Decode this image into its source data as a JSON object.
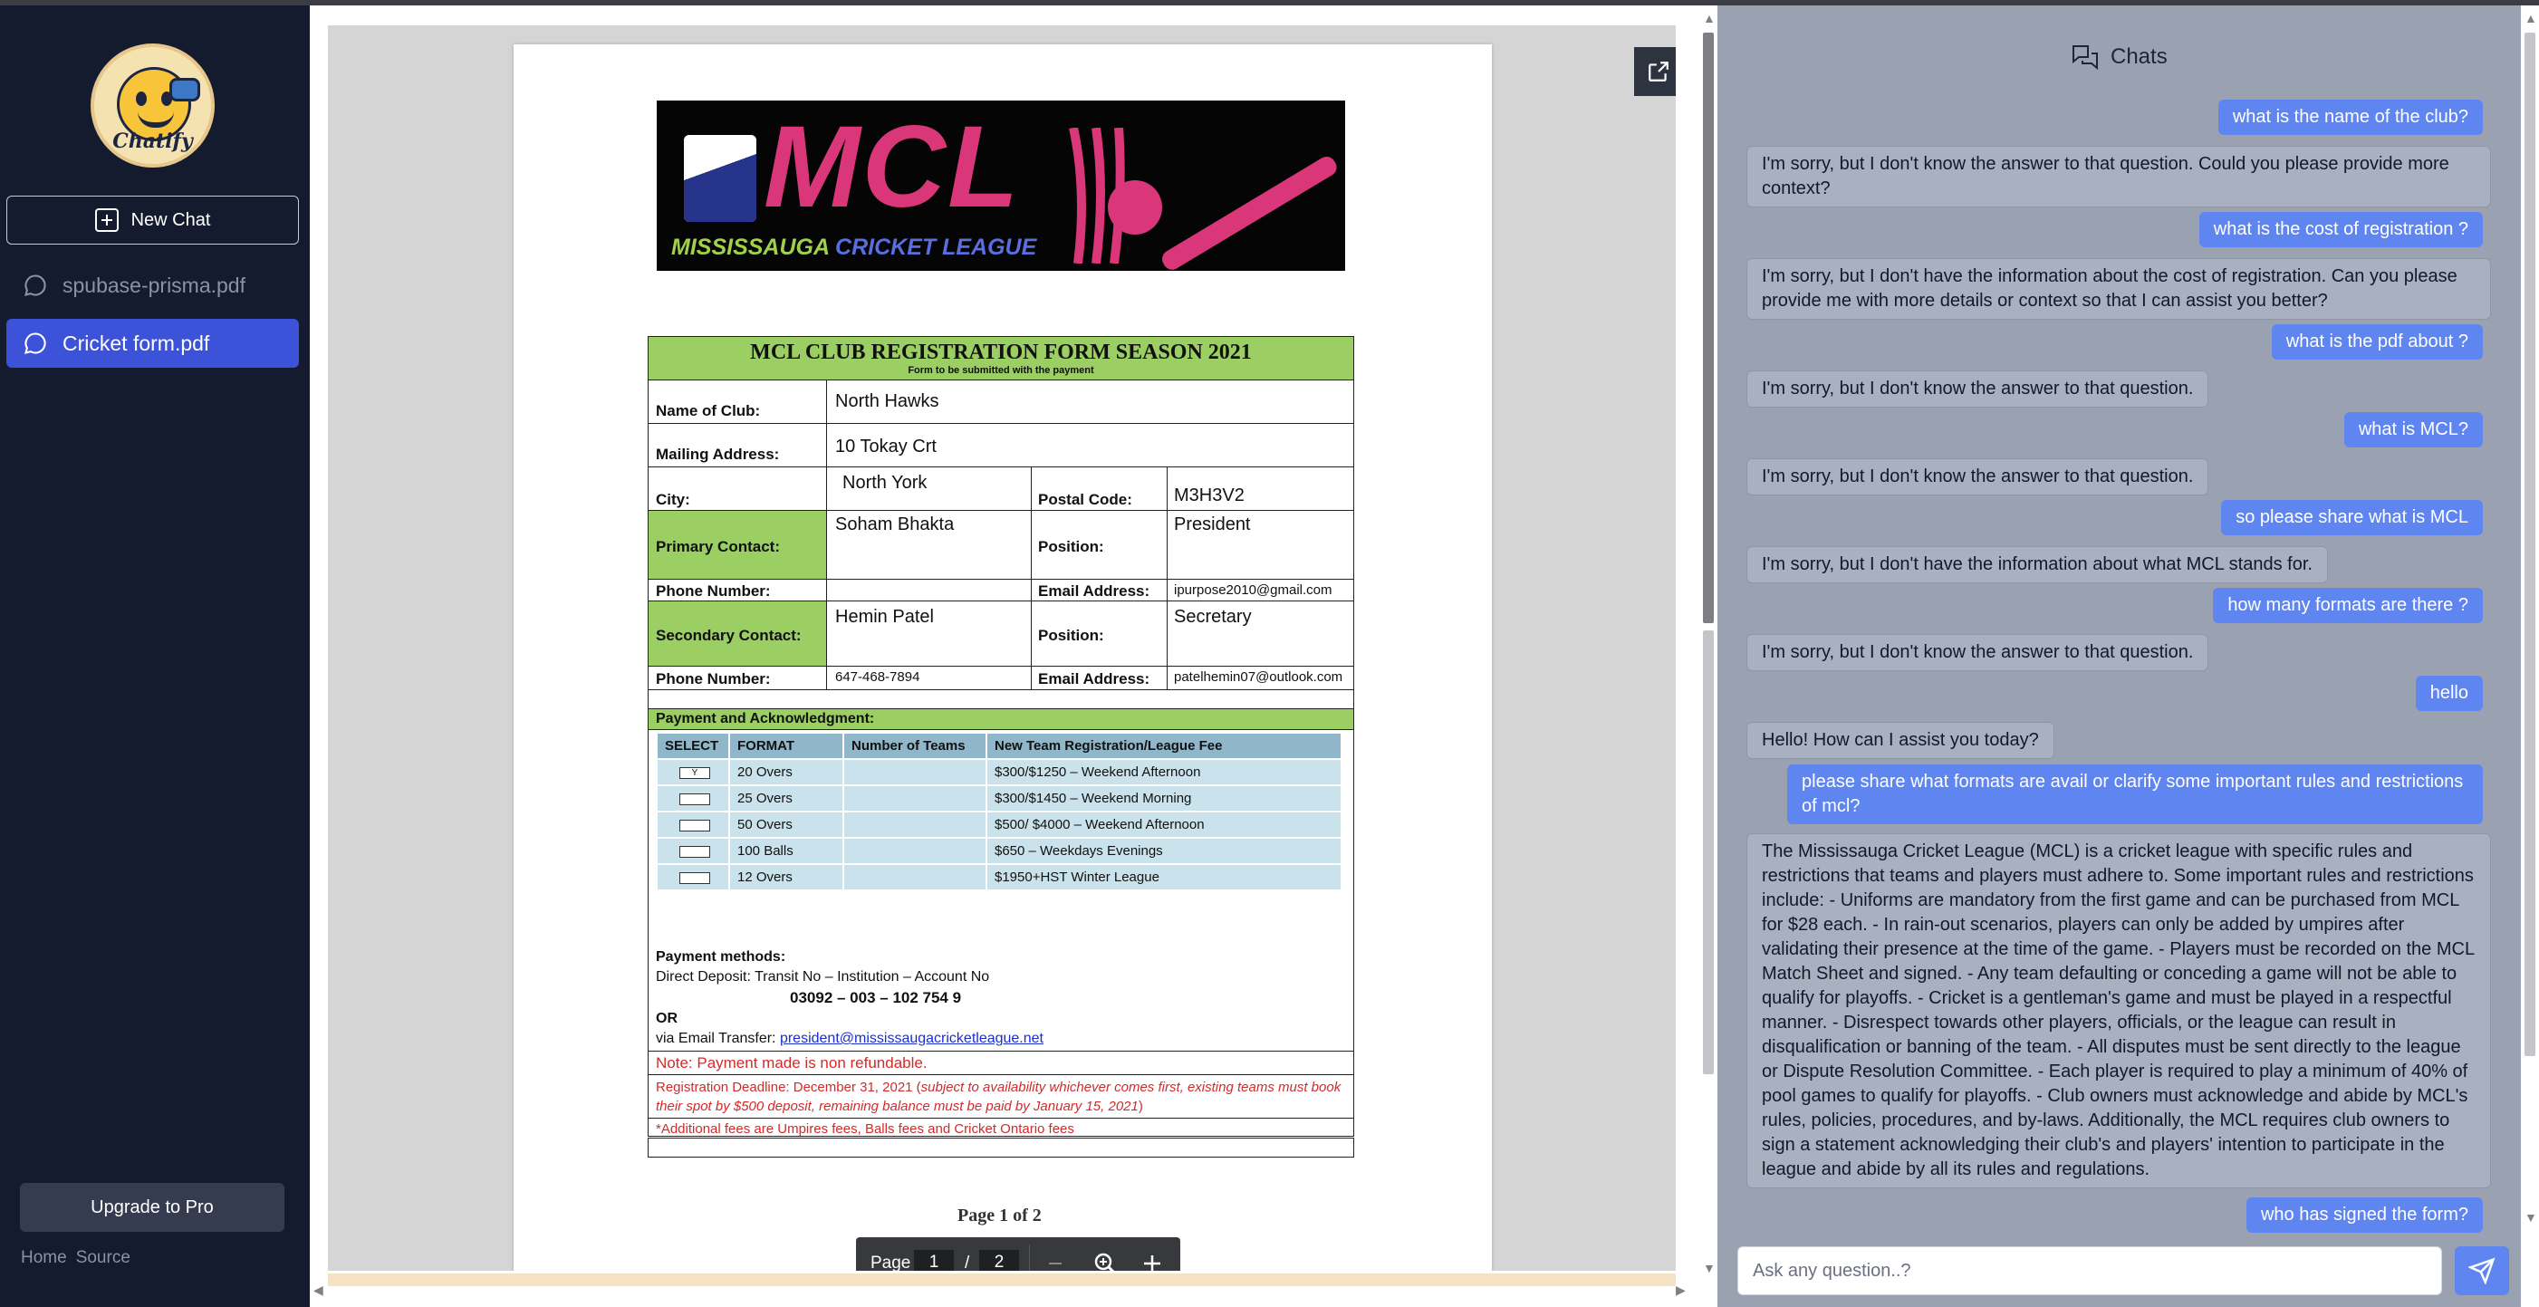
{
  "sidebar": {
    "logo_text": "Chatify",
    "new_chat_label": "New Chat",
    "chats": [
      {
        "label": "spubase-prisma.pdf",
        "active": false
      },
      {
        "label": "Cricket form.pdf",
        "active": true
      }
    ],
    "upgrade_label": "Upgrade to Pro",
    "links": [
      "Home",
      "Source"
    ]
  },
  "pdf": {
    "banner": {
      "title": "MCL",
      "sub_green": "MISSISSAUGA ",
      "sub_blue": "CRICKET LEAGUE"
    },
    "form": {
      "title": "MCL CLUB REGISTRATION FORM SEASON 2021",
      "subtitle": "Form to be submitted with the payment",
      "name_label": "Name of Club:",
      "name_value": "North Hawks",
      "mail_label": "Mailing Address:",
      "mail_value": "10 Tokay Crt",
      "city_label": "City:",
      "city_value": "North York",
      "postal_label": "Postal Code:",
      "postal_value": "M3H3V2",
      "primary_label": "Primary Contact:",
      "primary_value": "Soham Bhakta",
      "position_label": "Position:",
      "primary_position": "President",
      "phone_label": "Phone Number:",
      "phone1_value": "",
      "email_label": "Email Address:",
      "email1_value": "ipurpose2010@gmail.com",
      "secondary_label": "Secondary Contact:",
      "secondary_value": "Hemin Patel",
      "secondary_position": "Secretary",
      "phone2_value": "647-468-7894",
      "email2_value": "patelhemin07@outlook.com",
      "payment_header": "Payment and Acknowledgment:",
      "fee_headers": [
        "SELECT",
        "FORMAT",
        "Number of Teams",
        "New Team Registration/League Fee"
      ],
      "fee_rows": [
        {
          "check": "Y",
          "format": "20 Overs",
          "teams": "",
          "fee": "$300/$1250 – Weekend Afternoon"
        },
        {
          "check": "",
          "format": "25 Overs",
          "teams": "",
          "fee": "$300/$1450 – Weekend Morning"
        },
        {
          "check": "",
          "format": "50 Overs",
          "teams": "",
          "fee": "$500/ $4000 – Weekend Afternoon"
        },
        {
          "check": "",
          "format": "100 Balls",
          "teams": "",
          "fee": "$650 – Weekdays Evenings"
        },
        {
          "check": "",
          "format": "12 Overs",
          "teams": "",
          "fee": "$1950+HST  Winter League"
        }
      ],
      "payment_methods_label": "Payment methods:",
      "direct_deposit": "Direct Deposit: Transit No – Institution – Account No",
      "account_number": "03092 – 003 – 102 754 9",
      "or": "OR",
      "email_transfer_prefix": "via Email Transfer:",
      "email_transfer_link": "president@mississaugacricketleague.net",
      "note": "Note: Payment made is non refundable.",
      "deadline_prefix": "Registration  Deadline: December 31, 2021 (",
      "deadline_italic": "subject to availability whichever comes first, existing teams must book their spot by $500 deposit, remaining balance must be paid by January 15, 2021",
      "deadline_suffix": ")",
      "additional_fees": "*Additional fees are Umpires fees, Balls fees and Cricket Ontario fees"
    },
    "page_overlay_text": "Page 1 of 2",
    "pagebar": {
      "label": "Page",
      "current": "1",
      "separator": "/",
      "total": "2"
    }
  },
  "chat": {
    "header": "Chats",
    "messages": [
      {
        "role": "user",
        "text": "what is the name of the club?"
      },
      {
        "role": "bot",
        "text": "I'm sorry, but I don't know the answer to that question. Could you please provide more context?"
      },
      {
        "role": "user",
        "text": "what is the cost of registration ?"
      },
      {
        "role": "bot",
        "text": "I'm sorry, but I don't have the information about the cost of registration. Can you please provide me with more details or context so that I can assist you better?"
      },
      {
        "role": "user",
        "text": "what is the pdf about ?"
      },
      {
        "role": "bot",
        "text": "I'm sorry, but I don't know the answer to that question."
      },
      {
        "role": "user",
        "text": "what is MCL?"
      },
      {
        "role": "bot",
        "text": "I'm sorry, but I don't know the answer to that question."
      },
      {
        "role": "user",
        "text": "so please share what is MCL"
      },
      {
        "role": "bot",
        "text": "I'm sorry, but I don't have the information about what MCL stands for."
      },
      {
        "role": "user",
        "text": "how many formats are there ?"
      },
      {
        "role": "bot",
        "text": "I'm sorry, but I don't know the answer to that question."
      },
      {
        "role": "user",
        "text": "hello"
      },
      {
        "role": "bot",
        "text": "Hello! How can I assist you today?"
      },
      {
        "role": "user",
        "text": "please share what formats are avail or clarify some important rules and restrictions of mcl?"
      },
      {
        "role": "bot",
        "text": "The Mississauga Cricket League (MCL) is a cricket league with specific rules and restrictions that teams and players must adhere to. Some important rules and restrictions include: - Uniforms are mandatory from the first game and can be purchased from MCL for $28 each. - In rain-out scenarios, players can only be added by umpires after validating their presence at the time of the game. - Players must be recorded on the MCL Match Sheet and signed. - Any team defaulting or conceding a game will not be able to qualify for playoffs. - Cricket is a gentleman's game and must be played in a respectful manner. - Disrespect towards other players, officials, or the league can result in disqualification or banning of the team. - All disputes must be sent directly to the league or Dispute Resolution Committee. - Each player is required to play a minimum of 40% of pool games to qualify for playoffs. - Club owners must acknowledge and abide by MCL's rules, policies, procedures, and by-laws. Additionally, the MCL requires club owners to sign a statement acknowledging their club's and players' intention to participate in the league and abide by all its rules and regulations."
      },
      {
        "role": "user",
        "text": "who has signed the form?"
      }
    ],
    "input_placeholder": "Ask any question..?"
  },
  "colors": {
    "sidebar_bg": "#151b2e",
    "accent": "#3b52d9",
    "user_bubble": "#5f86f0",
    "chat_bg": "#9aa2b2",
    "form_green": "#9bce63",
    "brand_pink": "#d9377a"
  }
}
